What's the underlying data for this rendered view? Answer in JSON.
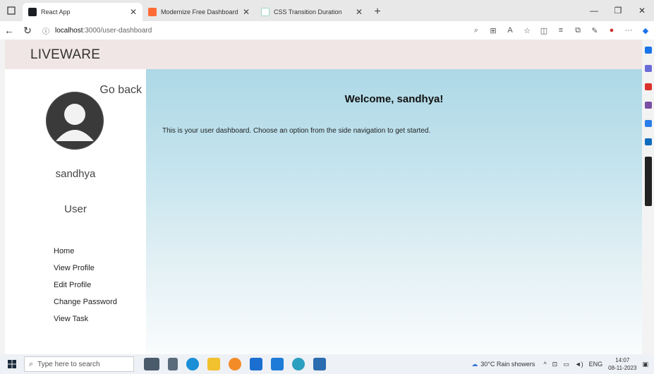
{
  "browser": {
    "tabs": [
      {
        "title": "React App",
        "active": true,
        "favicon_color": "#1b1f24"
      },
      {
        "title": "Modernize Free Dashboard Desi",
        "active": false,
        "favicon_color": "#ff6b35"
      },
      {
        "title": "CSS Transition Duration",
        "active": false,
        "favicon_color": "#9fd9c8"
      }
    ],
    "new_tab_label": "+",
    "url": {
      "host": "localhost",
      "path": ":3000/user-dashboard"
    }
  },
  "page": {
    "brand": "LIVEWARE",
    "go_back": "Go back",
    "username": "sandhya",
    "role": "User",
    "nav_items": [
      "Home",
      "View Profile",
      "Edit Profile",
      "Change Password",
      "View Task"
    ],
    "welcome": "Welcome, sandhya!",
    "intro": "This is your user dashboard. Choose an option from the side navigation to get started."
  },
  "taskbar": {
    "search_placeholder": "Type here to search",
    "weather": "30°C  Rain showers",
    "language": "ENG",
    "time": "14:07",
    "date": "08-11-2023"
  },
  "colors": {
    "topbar": "#f1e6e6",
    "main_gradient_top": "#add8e6",
    "main_gradient_bottom": "#fafcfd"
  }
}
